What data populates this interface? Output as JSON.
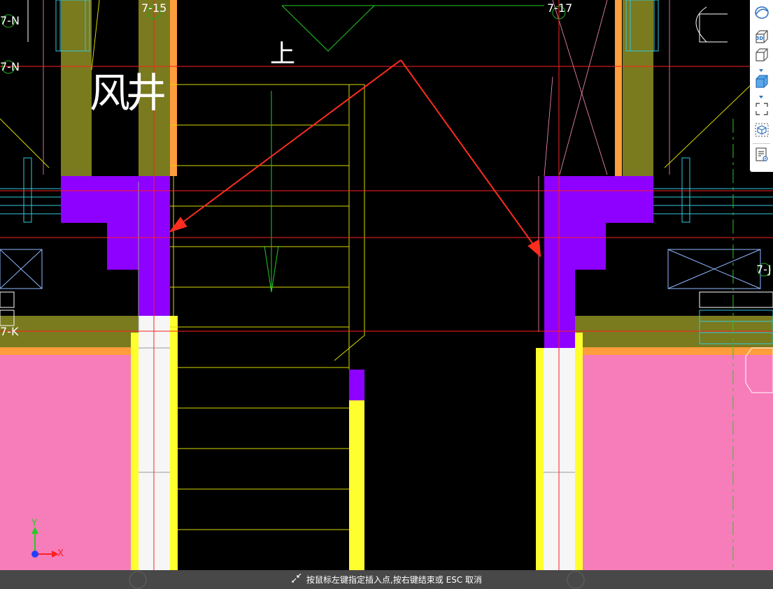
{
  "axes": {
    "top_left": "7-15",
    "top_right": "7-17",
    "left_row_1": "7-N",
    "left_row_2": "7-N",
    "left_row_3": "7-K",
    "right_row": "7-J"
  },
  "drawing_text": {
    "shaft": "风井",
    "stair_up": "上"
  },
  "status_bar": {
    "prompt": "按鼠标左键指定插入点,按右键结束或 ESC 取消"
  },
  "ucs": {
    "x_label": "X",
    "y_label": "Y"
  },
  "toolbar": {
    "view_3d_label": "3D"
  },
  "colors": {
    "background": "#000000",
    "wall_olive": "#7a7a1e",
    "column_purple": "#8e00ff",
    "slab_pink": "#f77dba",
    "beam_orange": "#ff9d3c",
    "beam_yellow": "#ffff2e",
    "axis_red": "#ff2020",
    "annotation_red": "#ff2d1f",
    "stair_yellow": "#d8d800",
    "arrow_green": "#22cc22",
    "cyan": "#30c8e0"
  }
}
